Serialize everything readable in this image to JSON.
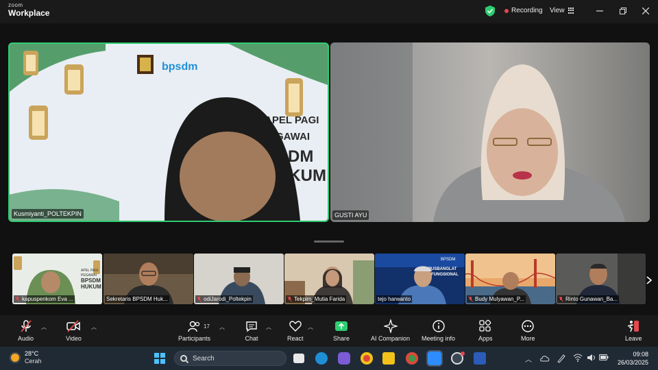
{
  "app": {
    "brand_small": "zoom",
    "brand_large": "Workplace",
    "recording_label": "Recording",
    "view_label": "View"
  },
  "main_tiles": [
    {
      "name": "Kusmiyanti_POLTEKPIN",
      "bg_text_1": "bpsdm",
      "bg_text_2": "APEL PAGI",
      "bg_text_3": "EGAWAI",
      "bg_text_4": "SDM",
      "bg_text_5": "UKUM",
      "active_speaker": true
    },
    {
      "name": "GUSTI AYU",
      "active_speaker": false
    }
  ],
  "thumbnails": [
    {
      "name": "kapuspenkom Eva ...",
      "muted": true,
      "sign_text_1": "APEL PAGI",
      "sign_text_2": "PEGAWAI",
      "sign_text_3": "BPSDM",
      "sign_text_4": "HUKUM"
    },
    {
      "name": "Sekretaris BPSDM Huk...",
      "muted": false
    },
    {
      "name": "odiJarodi_Poltekpin",
      "muted": true
    },
    {
      "name": "Tekpim_Mutia Farida",
      "muted": true
    },
    {
      "name": "tejo harwanto",
      "muted": false,
      "sign_text_1": "BPSDM",
      "sign_text_2": "PUSBANGLAT",
      "sign_text_3": "FUNGSIONAL"
    },
    {
      "name": "Budy Mulyawan_P...",
      "muted": true
    },
    {
      "name": "Rinto Gunawan_Ba...",
      "muted": true
    }
  ],
  "toolbar": {
    "audio": "Audio",
    "video": "Video",
    "participants": "Participants",
    "participants_count": "17",
    "chat": "Chat",
    "react": "React",
    "share": "Share",
    "ai_companion": "AI Companion",
    "meeting_info": "Meeting info",
    "apps": "Apps",
    "more": "More",
    "leave": "Leave"
  },
  "taskbar": {
    "temperature": "28°C",
    "weather": "Cerah",
    "search_placeholder": "Search",
    "time": "09:08",
    "date": "26/03/2025"
  },
  "colors": {
    "active_border": "#2ecc71",
    "record_dot": "#e5484d",
    "share_green": "#2ecc71",
    "leave_red": "#e5484d",
    "taskbar_bg": "#202a35"
  }
}
